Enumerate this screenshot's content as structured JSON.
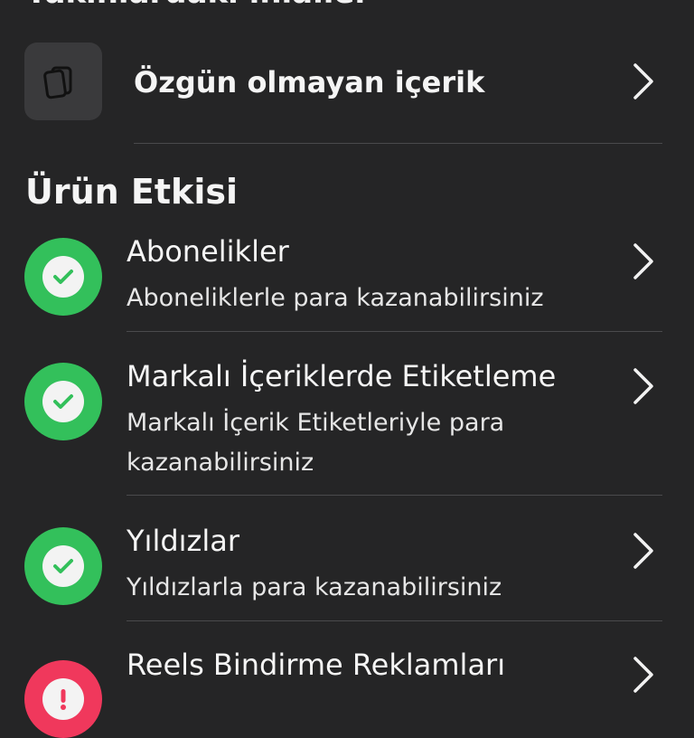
{
  "top_header": "Yakınlardaki ihlaller",
  "original_content": {
    "label": "Özgün olmayan içerik",
    "icon": "copy-documents-icon"
  },
  "section": {
    "title": "Ürün Etkisi"
  },
  "items": [
    {
      "title": "Abonelikler",
      "description": "Aboneliklerle para kazanabilirsiniz",
      "status": "ok",
      "status_icon": "checkmark-icon"
    },
    {
      "title": "Markalı İçeriklerde Etiketleme",
      "description": "Markalı İçerik Etiketleriyle para kazanabilirsiniz",
      "status": "ok",
      "status_icon": "checkmark-icon"
    },
    {
      "title": "Yıldızlar",
      "description": "Yıldızlarla para kazanabilirsiniz",
      "status": "ok",
      "status_icon": "checkmark-icon"
    },
    {
      "title": "Reels Bindirme Reklamları",
      "description": "",
      "status": "warn",
      "status_icon": "exclamation-icon"
    }
  ],
  "colors": {
    "background": "#252526",
    "tile": "#3a3a3c",
    "ok": "#33c05b",
    "warn": "#f0385c"
  }
}
